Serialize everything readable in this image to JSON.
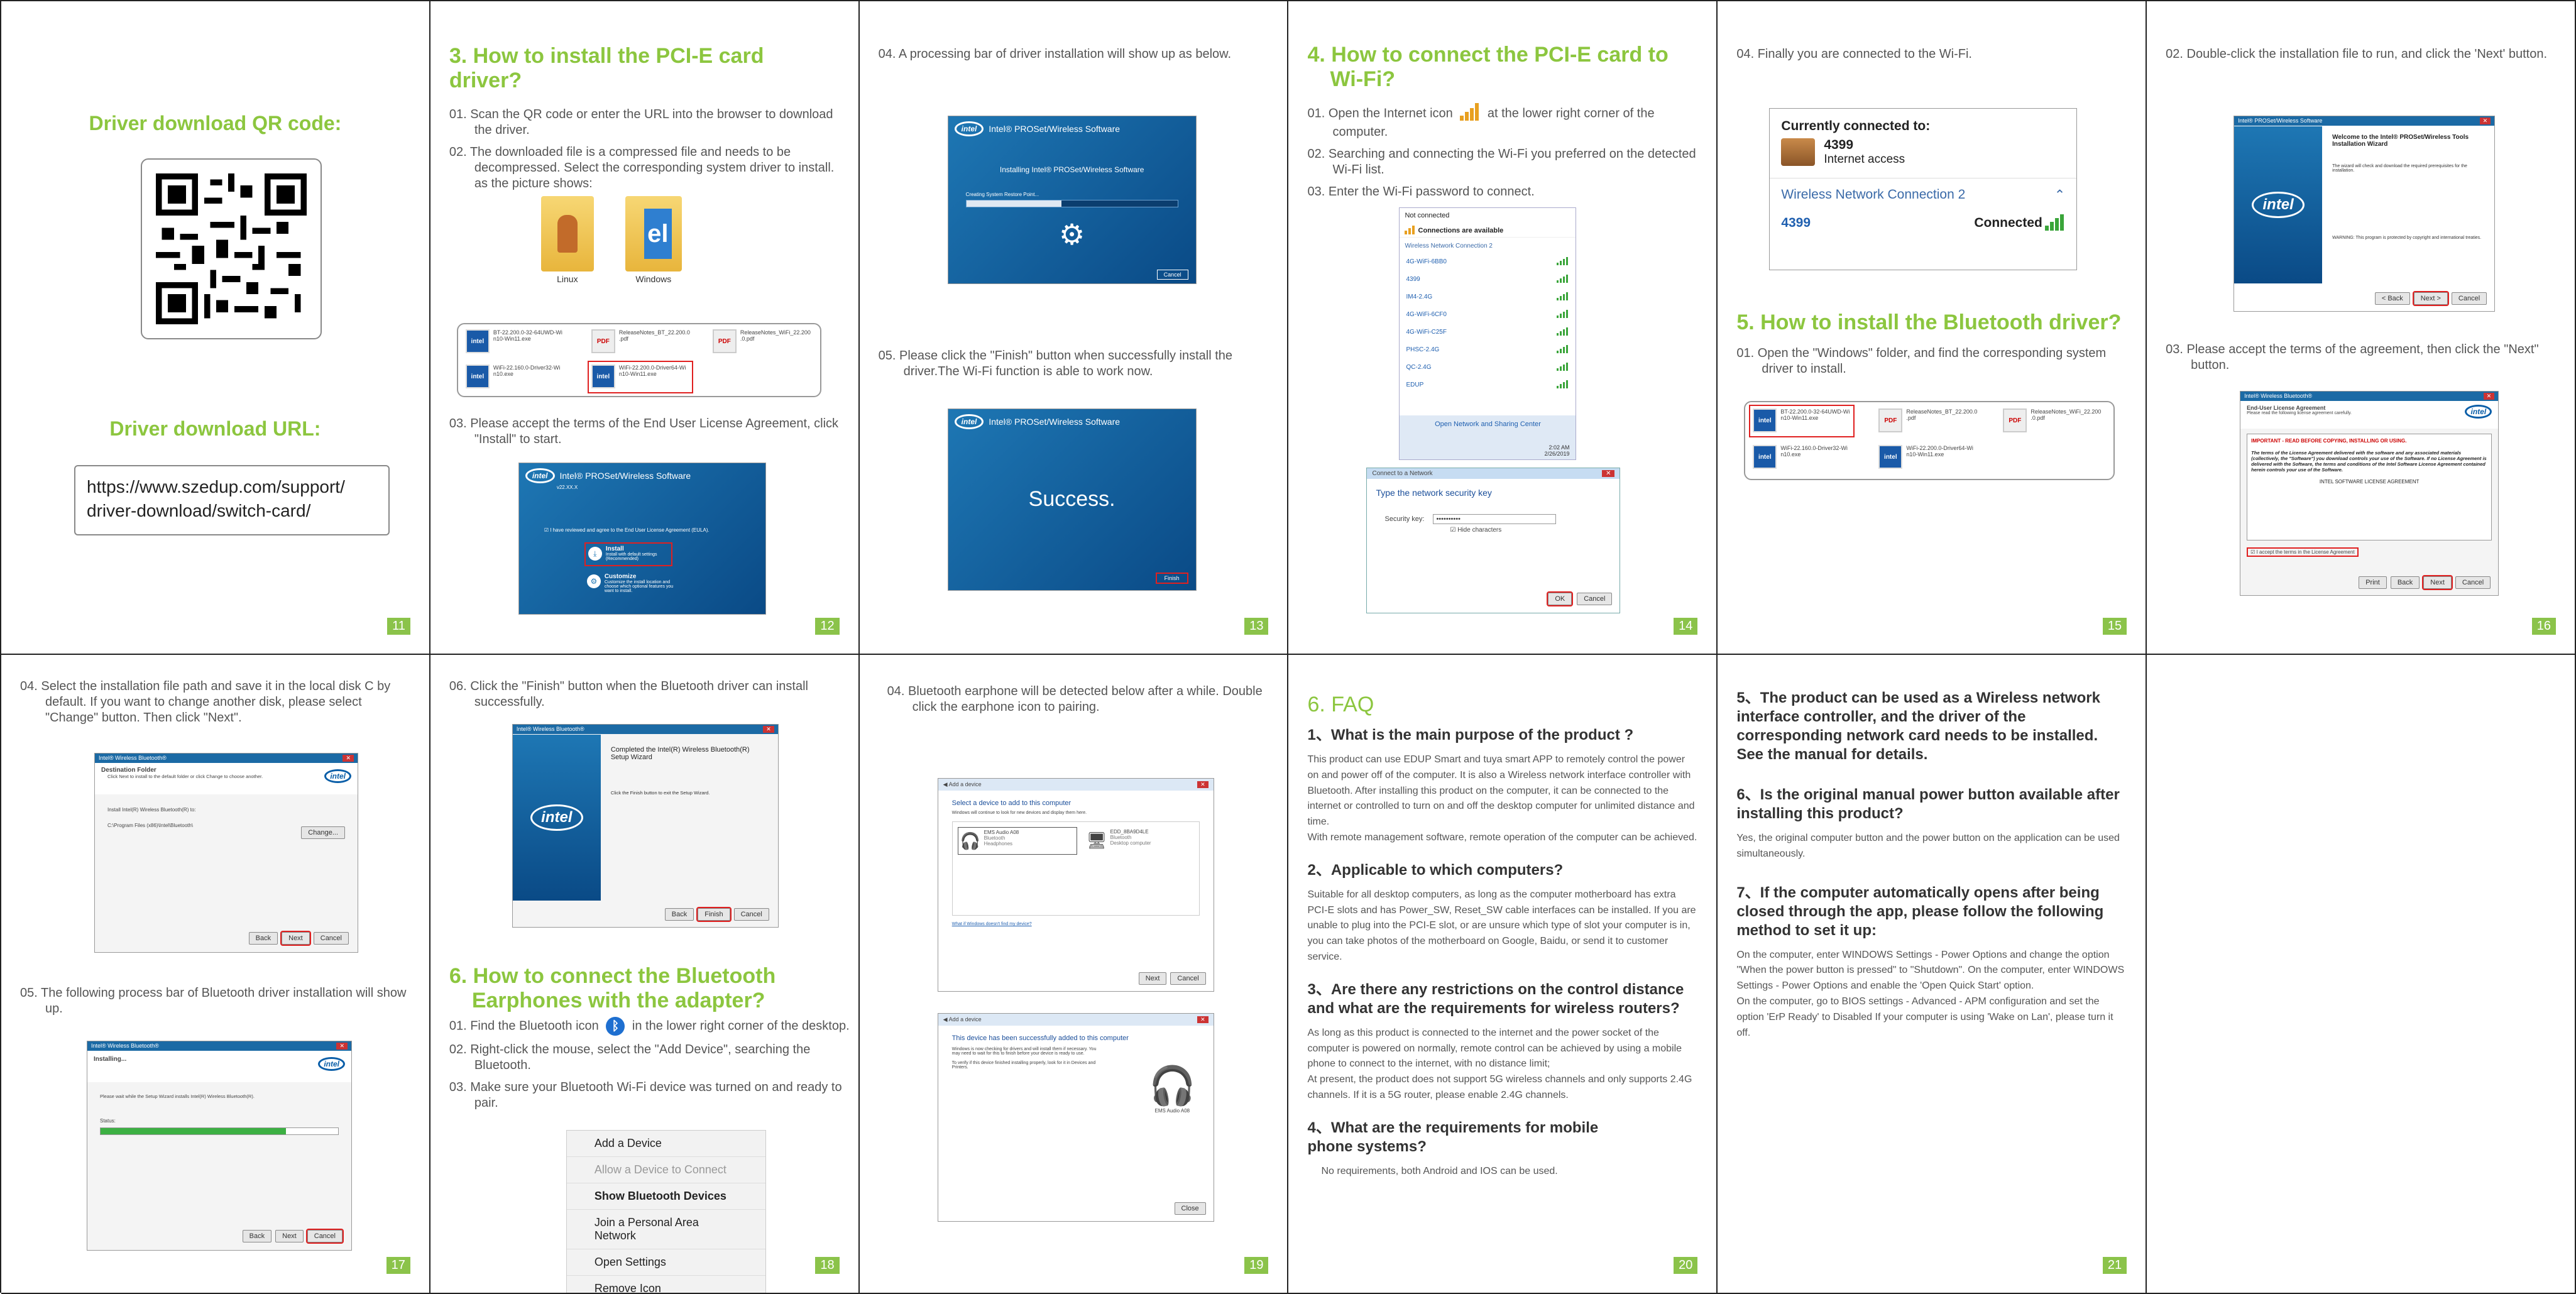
{
  "p11": {
    "qr_title": "Driver download QR code:",
    "url_title": "Driver download URL:",
    "url": "https://www.szedup.com/support/\ndriver-download/switch-card/",
    "num": "11"
  },
  "p12": {
    "title": "3. How to install the PCI-E card driver?",
    "s1": "01. Scan the QR code or enter the URL into the browser to download the driver.",
    "s2": "02. The downloaded file is a compressed file and needs to be decompressed. Select the corresponding system driver to install. as the picture shows:",
    "folder1": "Linux",
    "folder2": "Windows",
    "files": [
      "BT-22.200.0-32-64UWD-Wi\nn10-Win11.exe",
      "ReleaseNotes_BT_22.200.0\n.pdf",
      "ReleaseNotes_WiFi_22.200\n.0.pdf",
      "WiFi-22.160.0-Driver32-Wi\nn10.exe",
      "WiFi-22.200.0-Driver64-Wi\nn10-Win11.exe"
    ],
    "s3": "03. Please accept the terms of the End User License Agreement, click \"Install\" to start.",
    "win_title": "Intel® PROSet/Wireless Software",
    "win_ver": "v22.XX.X",
    "accept": "I have reviewed and agree to the End User License Agreement (EULA).",
    "install": "Install",
    "install_sub": "Install with default settings (Recommended)",
    "customize": "Customize",
    "customize_sub": "Customize the install location and choose which optional features you want to install.",
    "num": "12"
  },
  "p13": {
    "s4": "04. A processing bar of driver installation will show up as below.",
    "win_title": "Intel® PROSet/Wireless Software",
    "installing": "Installing Intel® PROSet/Wireless Software",
    "creating": "Creating System Restore Point...",
    "cancel": "Cancel",
    "s5": "05. Please click the \"Finish\" button when successfully install the driver.The Wi-Fi function is able to work now.",
    "success": "Success.",
    "finish": "Finish",
    "num": "13"
  },
  "p14": {
    "title": "4. How to connect the PCI-E card to Wi-Fi?",
    "s1a": "01. Open the Internet icon",
    "s1b": "at the lower right corner of the computer.",
    "s2": "02.  Searching and connecting the Wi-Fi you preferred on the detected Wi-Fi list.",
    "s3": "03. Enter the Wi-Fi password to connect.",
    "not_connected": "Not connected",
    "available": "Connections are available",
    "wnc": "Wireless Network Connection 2",
    "networks": [
      "4G-WiFi-6BB0",
      "4399",
      "IM4-2.4G",
      "4G-WiFi-6CF0",
      "4G-WiFi-C25F",
      "PHSC-2.4G",
      "QC-2.4G",
      "EDUP"
    ],
    "open_center": "Open Network and Sharing Center",
    "time": "2:02 AM",
    "date": "2/26/2019",
    "dlg_title": "Connect to a Network",
    "dlg_prompt": "Type the network security key",
    "sec_label": "Security key:",
    "sec_value": "••••••••••",
    "hide": "Hide characters",
    "ok": "OK",
    "cancel": "Cancel",
    "num": "14"
  },
  "p15": {
    "s4": "04. Finally you are connected to the Wi-Fi.",
    "currently": "Currently connected to:",
    "ssid": "4399",
    "access": "Internet access",
    "wnc": "Wireless Network Connection 2",
    "ssid2": "4399",
    "connected": "Connected",
    "title": "5. How to install the Bluetooth driver?",
    "s1": "01. Open the \"Windows\" folder, and find the corresponding system driver to install.",
    "num": "15"
  },
  "p16": {
    "s2": "02. Double-click the installation file to run, and click the 'Next' button.",
    "win_title": "Intel® PROSet/Wireless Software",
    "welcome": "Welcome to the Intel® PROSet/Wireless Tools Installation Wizard",
    "wizard_text": "The wizard will check and download the required prerequisites for the installation.",
    "warning": "WARNING: This program is protected by copyright and international treaties.",
    "back": "< Back",
    "next": "Next >",
    "cancel": "Cancel",
    "s3": "03. Please accept the terms of the agreement, then click the \"Next\" button.",
    "lic_win": "Intel® Wireless Bluetooth®",
    "lic_head": "End-User License Agreement",
    "lic_sub": "Please read the following license agreement carefully.",
    "important": "IMPORTANT - READ BEFORE COPYING, INSTALLING OR USING.",
    "lic_body": "The terms of the License Agreement delivered with the software and any associated materials (collectively, the \"Software\") you download controls your use of the Software. If no License Agreement is delivered with the Software, the terms and conditions of the Intel Software License Agreement contained herein controls your use of the Software.",
    "lic_title": "INTEL SOFTWARE LICENSE AGREEMENT",
    "accept": "I accept the terms in the License Agreement",
    "print": "Print",
    "num": "16"
  },
  "p17": {
    "s4": "04. Select the installation file path and save it in the local disk C by default. If you want to change another disk, please select \"Change\" button. Then click \"Next\".",
    "win_title": "Intel® Wireless Bluetooth®",
    "dest": "Destination Folder",
    "dest_sub": "Click Next to install to the default folder or click Change to choose another.",
    "install_to": "Install Intel(R) Wireless Bluetooth(R) to:",
    "path": "C:\\Program Files (x86)\\Intel\\Bluetooth\\",
    "change": "Change...",
    "back": "Back",
    "next": "Next",
    "cancel": "Cancel",
    "s5": "05. The following process bar of Bluetooth driver installation will show up.",
    "installing": "Installing...",
    "wait": "Please wait while the Setup Wizard installs Intel(R) Wireless Bluetooth(R).",
    "status": "Status:",
    "progress": 0.78,
    "num": "17"
  },
  "p18": {
    "s6": "06. Click the \"Finish\" button when the Bluetooth driver can install successfully.",
    "win_title": "Intel® Wireless Bluetooth®",
    "completed": "Completed the Intel(R) Wireless Bluetooth(R) Setup Wizard",
    "click_finish": "Click the Finish button to exit the Setup Wizard.",
    "back": "Back",
    "finish": "Finish",
    "cancel": "Cancel",
    "title": "6. How to connect the Bluetooth Earphones with the adapter?",
    "s1a": "01. Find the Bluetooth icon",
    "s1b": "in the lower right corner of the desktop.",
    "s2": "02. Right-click the mouse, select the \"Add Device\", searching the Bluetooth.",
    "s3": "03. Make sure your Bluetooth Wi-Fi device was turned on and ready to pair.",
    "menu": [
      "Add a Device",
      "Allow a Device to Connect",
      "Show Bluetooth Devices",
      "Join a Personal Area Network",
      "Open Settings",
      "Remove Icon"
    ],
    "num": "18"
  },
  "p19": {
    "s4": "04. Bluetooth earphone will be detected below after a while. Double click the earphone icon to pairing.",
    "add": "Add a device",
    "select": "Select a device to add to this computer",
    "looking": "Windows will continue to look for new devices and display them here.",
    "dev1": "EMS Audio A08",
    "dev1b": "Bluetooth",
    "dev1c": "Headphones",
    "dev2": "EDD_8BA9D4LE",
    "dev2b": "Bluetooth",
    "dev2c": "Desktop computer",
    "what": "What if Windows doesn't find my device?",
    "next": "Next",
    "cancel": "Cancel",
    "added": "This device has been successfully added to this computer",
    "added_sub": "Windows is now checking for drivers and will install them if necessary. You may need to wait for this to finish before your device is ready to use.",
    "verify": "To verify if this device finished installing properly, look for it in Devices and Printers.",
    "dev_label": "EMS Audio A08",
    "close": "Close",
    "num": "19"
  },
  "p20": {
    "title": "6. FAQ",
    "q1": "1、What is the main purpose of the product ?",
    "a1": "This product can use EDUP Smart and tuya smart APP to remotely control the power on and power off of the computer. It is also a Wireless network interface controller with Bluetooth. After installing this product on the computer, it can be connected to the internet or controlled to turn on and off the desktop computer for unlimited distance and time.\nWith remote management software, remote operation of the computer can be achieved.",
    "q2": "2、Applicable to which computers?",
    "a2": "Suitable for all desktop computers, as long as the computer motherboard has extra PCI-E slots and has Power_SW, Reset_SW cable interfaces can be installed. If you are unable to plug into the PCI-E slot, or are unsure which type of slot your computer is in, you can take photos of the motherboard on Google, Baidu, or send it to customer service.",
    "q3": "3、Are there any restrictions on the control distance and what are the requirements for wireless routers?",
    "a3": "As long as this product is connected to the internet and the power socket of the computer is powered on normally, remote control can be achieved by using a mobile phone to connect to the internet, with no distance limit;\nAt present, the product does not support 5G wireless channels and only supports 2.4G channels. If it is a 5G router, please enable 2.4G channels.",
    "q4": "4、What are the requirements for mobile\n    phone systems?",
    "a4": "No requirements, both Android and IOS can be used.",
    "num": "20"
  },
  "p21": {
    "q5": "5、The product can be used as a Wireless network interface controller, and the driver of the corresponding network card needs to be installed. See the manual for details.",
    "q6": "6、Is the original manual power button available after installing this product?",
    "a6": "Yes, the original computer button and the power button on the application can be used simultaneously.",
    "q7": "7、If the computer automatically opens after being closed through the app, please follow the following method to set it up:",
    "a7": "On the computer, enter WINDOWS Settings - Power Options and change the option \"When the power button is pressed\" to \"Shutdown\". On the computer, enter WINDOWS Settings - Power Options and enable the 'Open Quick Start' option.\nOn the computer, go to BIOS settings - Advanced - APM configuration and set the option 'ErP Ready' to Disabled If your computer is using 'Wake on Lan', please turn it off.",
    "num": "21"
  },
  "colors": {
    "accent": "#8cc63f",
    "intel": "#0a5ea8",
    "red": "#e02020"
  }
}
